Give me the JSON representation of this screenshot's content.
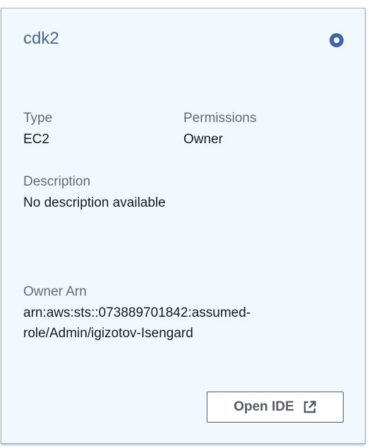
{
  "card": {
    "title": "cdk2",
    "selected": true,
    "fields": {
      "type_label": "Type",
      "type_value": "EC2",
      "permissions_label": "Permissions",
      "permissions_value": "Owner",
      "description_label": "Description",
      "description_value": "No description available",
      "owner_arn_label": "Owner Arn",
      "owner_arn_line1": "arn:aws:sts::073889701842:assumed-",
      "owner_arn_line2": "role/Admin/igizotov-Isengard"
    },
    "button": {
      "label": "Open IDE",
      "icon": "external-link-icon"
    }
  },
  "colors": {
    "title": "#44679c",
    "card_background": "#f1f8fe",
    "card_border": "#99b8d9",
    "radio": "#3b67a8"
  }
}
